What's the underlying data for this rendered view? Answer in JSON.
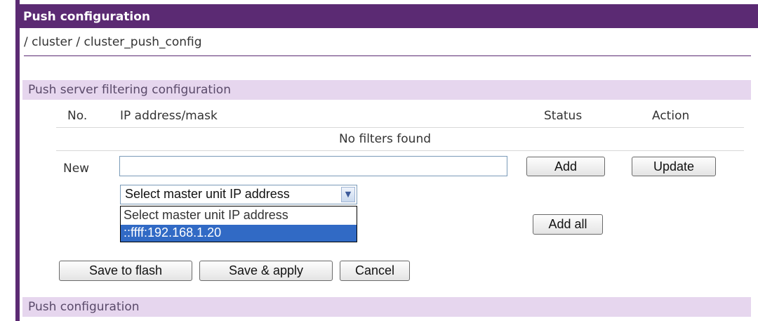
{
  "header": {
    "title": "Push configuration"
  },
  "breadcrumb": "/ cluster / cluster_push_config",
  "filter_section": {
    "title": "Push server filtering configuration",
    "columns": {
      "no": "No.",
      "ip": "IP address/mask",
      "status": "Status",
      "action": "Action"
    },
    "empty_message": "No filters found",
    "new_row": {
      "label": "New",
      "ip_value": "",
      "add_label": "Add",
      "update_label": "Update",
      "master_select": {
        "selected": "Select master unit IP address",
        "options": [
          "Select master unit IP address",
          "::ffff:192.168.1.20"
        ]
      },
      "add_all_label": "Add all"
    }
  },
  "actions": {
    "save_flash": "Save to flash",
    "save_apply": "Save & apply",
    "cancel": "Cancel"
  },
  "push_section": {
    "title": "Push configuration"
  },
  "colors": {
    "brand": "#5b2a73",
    "section_bg": "#e6d6ee",
    "highlight": "#316ac5"
  }
}
